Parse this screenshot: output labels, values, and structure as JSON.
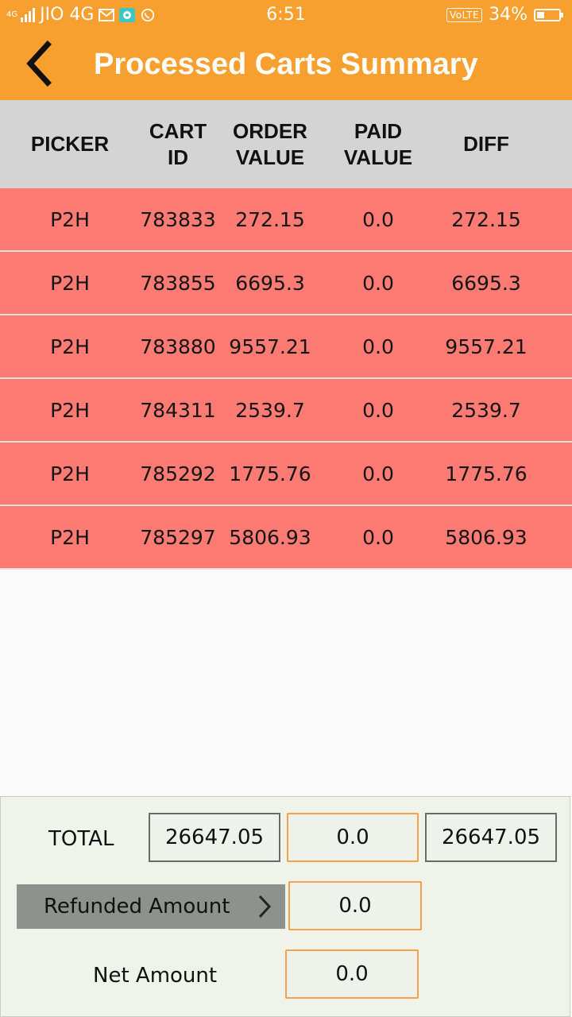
{
  "status_bar": {
    "network": "JIO 4G",
    "network_tag": "4G",
    "time": "6:51",
    "volte": "VoLTE",
    "battery": "34%",
    "battery_level": 0.34,
    "icons": [
      "signal-icon",
      "mail-icon",
      "chat-app-icon",
      "whatsapp-icon",
      "battery-icon"
    ]
  },
  "header": {
    "title": "Processed Carts Summary",
    "back_icon": "chevron-left-icon",
    "background_color": "#f7a030"
  },
  "table": {
    "columns": [
      "PICKER",
      "CART ID",
      "ORDER\nVALUE",
      "PAID\nVALUE",
      "DIFF"
    ],
    "rows": [
      [
        "P2H",
        "783833",
        "272.15",
        "0.0",
        "272.15"
      ],
      [
        "P2H",
        "783855",
        "6695.3",
        "0.0",
        "6695.3"
      ],
      [
        "P2H",
        "783880",
        "9557.21",
        "0.0",
        "9557.21"
      ],
      [
        "P2H",
        "784311",
        "2539.7",
        "0.0",
        "2539.7"
      ],
      [
        "P2H",
        "785292",
        "1775.76",
        "0.0",
        "1775.76"
      ],
      [
        "P2H",
        "785297",
        "5806.93",
        "0.0",
        "5806.93"
      ]
    ],
    "row_color": "#fe7b74",
    "header_color": "#d4d4d4"
  },
  "summary": {
    "total_label": "TOTAL",
    "total_order_value": "26647.05",
    "total_paid_value": "0.0",
    "total_diff": "26647.05",
    "refunded_label": "Refunded Amount",
    "refunded_value": "0.0",
    "refund_icon": "chevron-right-icon",
    "net_label": "Net Amount",
    "net_value": "0.0",
    "accent_border_color": "#f2a24a"
  }
}
